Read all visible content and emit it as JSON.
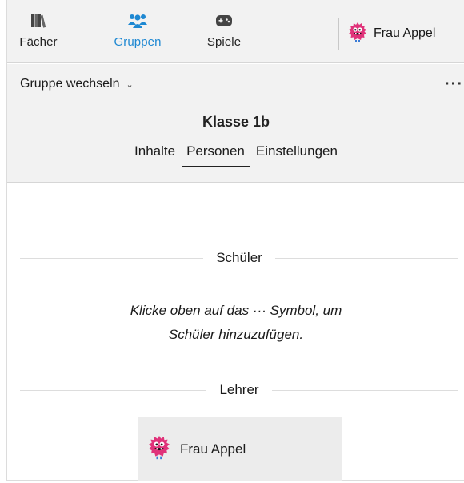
{
  "nav": {
    "items": [
      {
        "label": "Fächer",
        "icon": "books-icon",
        "active": false
      },
      {
        "label": "Gruppen",
        "icon": "group-icon",
        "active": true
      },
      {
        "label": "Spiele",
        "icon": "gamepad-icon",
        "active": false
      }
    ],
    "user": {
      "name": "Frau Appel",
      "icon": "monster-avatar-icon"
    }
  },
  "subheader": {
    "switch_group_label": "Gruppe wechseln",
    "more_label": "···",
    "group_title": "Klasse 1b",
    "tabs": [
      {
        "label": "Inhalte",
        "active": false
      },
      {
        "label": "Personen",
        "active": true
      },
      {
        "label": "Einstellungen",
        "active": false
      }
    ]
  },
  "content": {
    "students_heading": "Schüler",
    "students_hint_line1": "Klicke oben auf das ··· Symbol, um",
    "students_hint_line2": "Schüler hinzuzufügen.",
    "teachers_heading": "Lehrer",
    "teachers": [
      {
        "name": "Frau Appel",
        "icon": "monster-avatar-icon"
      }
    ]
  },
  "colors": {
    "accent": "#1e88d2",
    "bar_background": "#f2f2f2",
    "card_background": "#ececec",
    "avatar_pink": "#e0337a"
  }
}
